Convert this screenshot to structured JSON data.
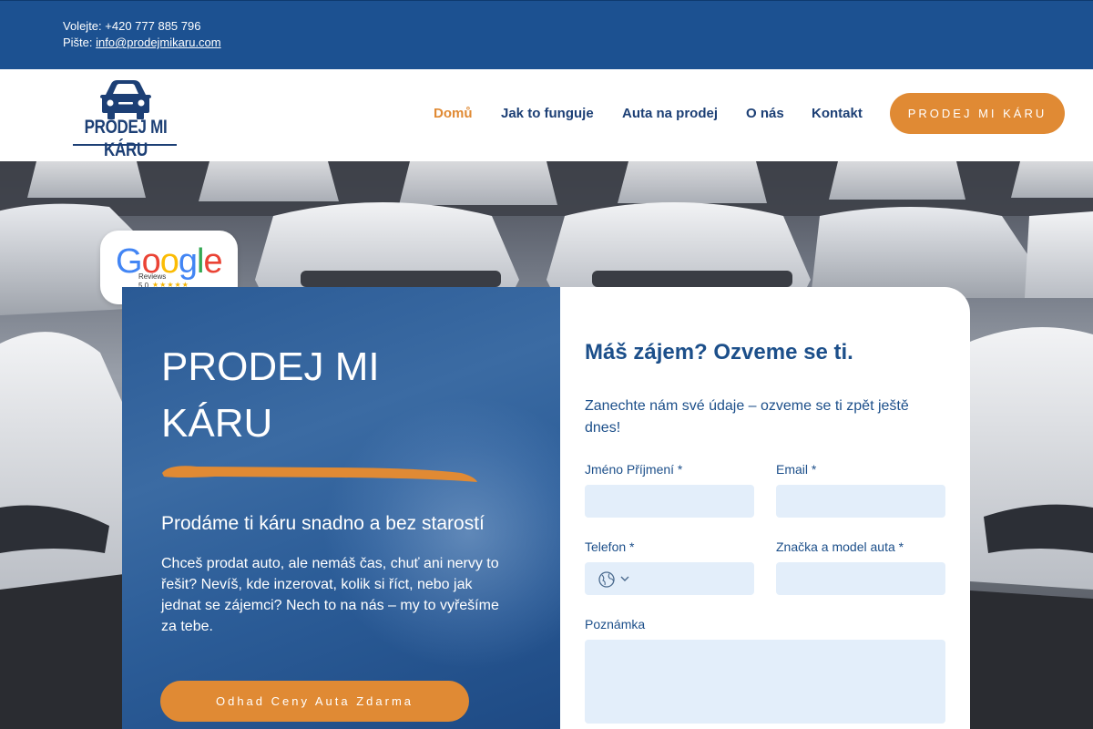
{
  "topbar": {
    "phone_label": "Volejte:",
    "phone": "+420 777 885 796",
    "email_label": "Pište:",
    "email": "info@prodejmikaru.com"
  },
  "header": {
    "logo_text": "PRODEJ MI KÁRU",
    "nav": [
      {
        "label": "Domů",
        "active": true
      },
      {
        "label": "Jak to funguje",
        "active": false
      },
      {
        "label": "Auta na prodej",
        "active": false
      },
      {
        "label": "O nás",
        "active": false
      },
      {
        "label": "Kontakt",
        "active": false
      }
    ],
    "cta_label": "PRODEJ MI KÁRU"
  },
  "badge": {
    "brand": "Google",
    "reviews_label": "Reviews",
    "rating": "5.0",
    "stars": "★★★★★"
  },
  "hero": {
    "title": "PRODEJ MI KÁRU",
    "subtitle": "Prodáme ti káru snadno a bez starostí",
    "text": "Chceš prodat auto, ale nemáš čas, chuť ani nervy to řešit? Nevíš, kde inzerovat, kolik si říct, nebo jak jednat se zájemci? Nech to na nás – my to vyřešíme za tebe.",
    "button_label": "Odhad Ceny Auta Zdarma"
  },
  "form": {
    "title": "Máš zájem? Ozveme se ti.",
    "intro": "Zanechte nám své údaje – ozveme se ti zpět ještě dnes!",
    "fields": {
      "name": {
        "label": "Jméno Příjmení *",
        "value": ""
      },
      "email": {
        "label": "Email *",
        "value": ""
      },
      "phone": {
        "label": "Telefon *",
        "value": ""
      },
      "car": {
        "label": "Značka a model auta *",
        "value": ""
      },
      "note": {
        "label": "Poznámka",
        "value": ""
      }
    }
  },
  "colors": {
    "primary_blue": "#1c5191",
    "accent_orange": "#e08a34",
    "input_bg": "#e3eefa"
  },
  "icons": {
    "logo": "car-icon",
    "phone_country": "globe-icon",
    "phone_dropdown": "chevron-down-icon"
  }
}
